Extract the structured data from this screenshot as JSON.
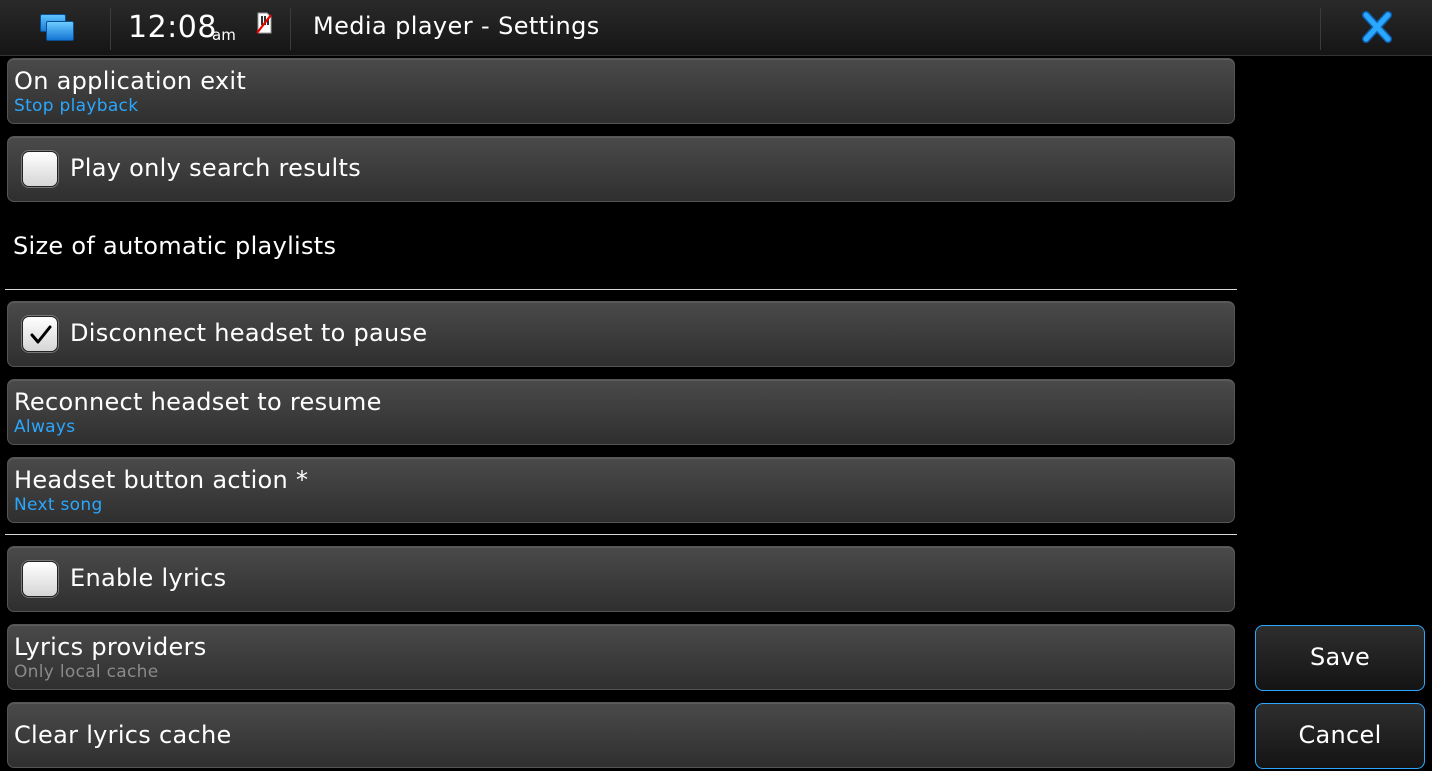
{
  "statusbar": {
    "time": "12:08",
    "ampm": "am",
    "title": "Media player - Settings",
    "icons": [
      "task-switcher-icon",
      "sim-card-icon",
      "close-icon"
    ],
    "accent_color": "#2aa7ff"
  },
  "settings": {
    "on_exit": {
      "label": "On application exit",
      "value": "Stop playback"
    },
    "play_search": {
      "label": "Play only search results",
      "checked": false
    },
    "playlist_heading": "Size of automatic playlists",
    "disconnect": {
      "label": "Disconnect headset to pause",
      "checked": true
    },
    "reconnect": {
      "label": "Reconnect headset to resume",
      "value": "Always"
    },
    "headset_button": {
      "label": "Headset button action *",
      "value": "Next song"
    },
    "enable_lyrics": {
      "label": "Enable lyrics",
      "checked": false
    },
    "lyrics_providers": {
      "label": "Lyrics providers",
      "value": "Only local cache"
    },
    "clear_cache": {
      "label": "Clear lyrics cache"
    }
  },
  "buttons": {
    "save": "Save",
    "cancel": "Cancel"
  }
}
